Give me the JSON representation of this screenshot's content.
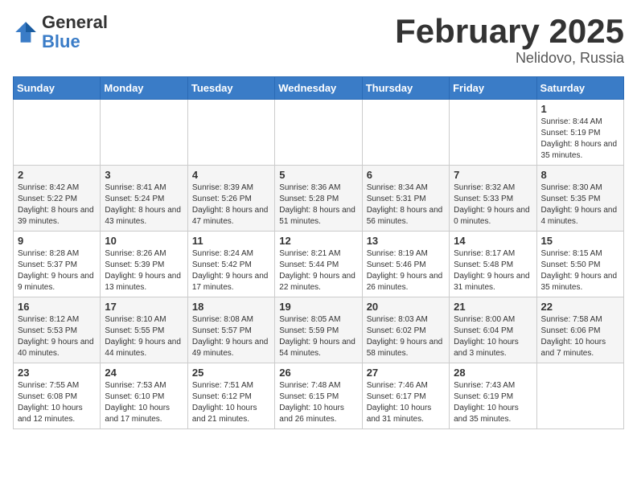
{
  "header": {
    "logo_general": "General",
    "logo_blue": "Blue",
    "month_title": "February 2025",
    "location": "Nelidovo, Russia"
  },
  "weekdays": [
    "Sunday",
    "Monday",
    "Tuesday",
    "Wednesday",
    "Thursday",
    "Friday",
    "Saturday"
  ],
  "weeks": [
    [
      {
        "day": "",
        "info": ""
      },
      {
        "day": "",
        "info": ""
      },
      {
        "day": "",
        "info": ""
      },
      {
        "day": "",
        "info": ""
      },
      {
        "day": "",
        "info": ""
      },
      {
        "day": "",
        "info": ""
      },
      {
        "day": "1",
        "info": "Sunrise: 8:44 AM\nSunset: 5:19 PM\nDaylight: 8 hours and 35 minutes."
      }
    ],
    [
      {
        "day": "2",
        "info": "Sunrise: 8:42 AM\nSunset: 5:22 PM\nDaylight: 8 hours and 39 minutes."
      },
      {
        "day": "3",
        "info": "Sunrise: 8:41 AM\nSunset: 5:24 PM\nDaylight: 8 hours and 43 minutes."
      },
      {
        "day": "4",
        "info": "Sunrise: 8:39 AM\nSunset: 5:26 PM\nDaylight: 8 hours and 47 minutes."
      },
      {
        "day": "5",
        "info": "Sunrise: 8:36 AM\nSunset: 5:28 PM\nDaylight: 8 hours and 51 minutes."
      },
      {
        "day": "6",
        "info": "Sunrise: 8:34 AM\nSunset: 5:31 PM\nDaylight: 8 hours and 56 minutes."
      },
      {
        "day": "7",
        "info": "Sunrise: 8:32 AM\nSunset: 5:33 PM\nDaylight: 9 hours and 0 minutes."
      },
      {
        "day": "8",
        "info": "Sunrise: 8:30 AM\nSunset: 5:35 PM\nDaylight: 9 hours and 4 minutes."
      }
    ],
    [
      {
        "day": "9",
        "info": "Sunrise: 8:28 AM\nSunset: 5:37 PM\nDaylight: 9 hours and 9 minutes."
      },
      {
        "day": "10",
        "info": "Sunrise: 8:26 AM\nSunset: 5:39 PM\nDaylight: 9 hours and 13 minutes."
      },
      {
        "day": "11",
        "info": "Sunrise: 8:24 AM\nSunset: 5:42 PM\nDaylight: 9 hours and 17 minutes."
      },
      {
        "day": "12",
        "info": "Sunrise: 8:21 AM\nSunset: 5:44 PM\nDaylight: 9 hours and 22 minutes."
      },
      {
        "day": "13",
        "info": "Sunrise: 8:19 AM\nSunset: 5:46 PM\nDaylight: 9 hours and 26 minutes."
      },
      {
        "day": "14",
        "info": "Sunrise: 8:17 AM\nSunset: 5:48 PM\nDaylight: 9 hours and 31 minutes."
      },
      {
        "day": "15",
        "info": "Sunrise: 8:15 AM\nSunset: 5:50 PM\nDaylight: 9 hours and 35 minutes."
      }
    ],
    [
      {
        "day": "16",
        "info": "Sunrise: 8:12 AM\nSunset: 5:53 PM\nDaylight: 9 hours and 40 minutes."
      },
      {
        "day": "17",
        "info": "Sunrise: 8:10 AM\nSunset: 5:55 PM\nDaylight: 9 hours and 44 minutes."
      },
      {
        "day": "18",
        "info": "Sunrise: 8:08 AM\nSunset: 5:57 PM\nDaylight: 9 hours and 49 minutes."
      },
      {
        "day": "19",
        "info": "Sunrise: 8:05 AM\nSunset: 5:59 PM\nDaylight: 9 hours and 54 minutes."
      },
      {
        "day": "20",
        "info": "Sunrise: 8:03 AM\nSunset: 6:02 PM\nDaylight: 9 hours and 58 minutes."
      },
      {
        "day": "21",
        "info": "Sunrise: 8:00 AM\nSunset: 6:04 PM\nDaylight: 10 hours and 3 minutes."
      },
      {
        "day": "22",
        "info": "Sunrise: 7:58 AM\nSunset: 6:06 PM\nDaylight: 10 hours and 7 minutes."
      }
    ],
    [
      {
        "day": "23",
        "info": "Sunrise: 7:55 AM\nSunset: 6:08 PM\nDaylight: 10 hours and 12 minutes."
      },
      {
        "day": "24",
        "info": "Sunrise: 7:53 AM\nSunset: 6:10 PM\nDaylight: 10 hours and 17 minutes."
      },
      {
        "day": "25",
        "info": "Sunrise: 7:51 AM\nSunset: 6:12 PM\nDaylight: 10 hours and 21 minutes."
      },
      {
        "day": "26",
        "info": "Sunrise: 7:48 AM\nSunset: 6:15 PM\nDaylight: 10 hours and 26 minutes."
      },
      {
        "day": "27",
        "info": "Sunrise: 7:46 AM\nSunset: 6:17 PM\nDaylight: 10 hours and 31 minutes."
      },
      {
        "day": "28",
        "info": "Sunrise: 7:43 AM\nSunset: 6:19 PM\nDaylight: 10 hours and 35 minutes."
      },
      {
        "day": "",
        "info": ""
      }
    ]
  ]
}
